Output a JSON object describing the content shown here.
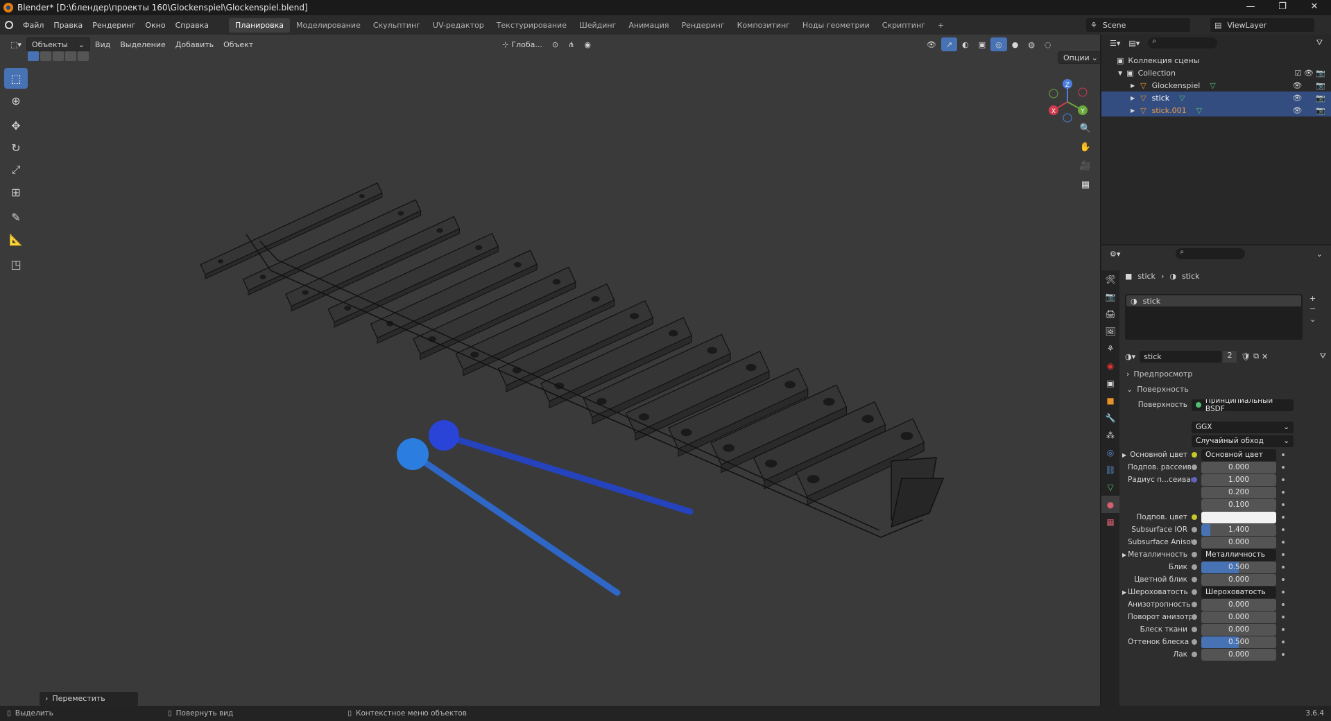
{
  "window": {
    "title": "Blender* [D:\\блендер\\проекты 160\\Glockenspiel\\Glockenspiel.blend]"
  },
  "menu": [
    "Файл",
    "Правка",
    "Рендеринг",
    "Окно",
    "Справка"
  ],
  "workspaces": {
    "active": "Планировка",
    "tabs": [
      "Моделирование",
      "Скульптинг",
      "UV-редактор",
      "Текстурирование",
      "Шейдинг",
      "Анимация",
      "Рендеринг",
      "Композитинг",
      "Ноды геометрии",
      "Скриптинг"
    ],
    "add": "+"
  },
  "scene": {
    "name": "Scene",
    "view_layer": "ViewLayer"
  },
  "viewport": {
    "mode": "Объекты",
    "menu": [
      "Вид",
      "Выделение",
      "Добавить",
      "Объект"
    ],
    "transform_orientation": "Глоба...",
    "options": "Опции",
    "last_operator": "Переместить"
  },
  "gizmo": {
    "x": "X",
    "y": "Y",
    "z": "Z"
  },
  "outliner": {
    "root": "Коллекция сцены",
    "collection": "Collection",
    "objects": [
      {
        "name": "Glockenspiel",
        "selected": false,
        "color": "#d6d6d6"
      },
      {
        "name": "stick",
        "selected": true,
        "color": "#ffffff"
      },
      {
        "name": "stick.001",
        "selected": true,
        "color": "#f0a040"
      }
    ]
  },
  "properties": {
    "breadcrumb": [
      "stick",
      "stick"
    ],
    "material_slot": "stick",
    "material_name": "stick",
    "users": "2",
    "panels": {
      "preview": "Предпросмотр",
      "surface": "Поверхность"
    },
    "surface_label": "Поверхность",
    "surface_shader": "Принципиальный BSDF",
    "distribution": "GGX",
    "subsurface_method": "Случайный обход",
    "rows": [
      {
        "label": "Основной цвет",
        "value": "Основной цвет",
        "type": "link",
        "sock": "#c7c729",
        "expand": true
      },
      {
        "label": "Подпов. рассеива...",
        "value": "0.000",
        "type": "num",
        "sock": "#a1a1a1",
        "fill": 0
      },
      {
        "label": "Радиус п...сеивания",
        "value": "1.000",
        "type": "num",
        "sock": "#6363c7",
        "fill": 0
      },
      {
        "label": "",
        "value": "0.200",
        "type": "num",
        "sock": "",
        "fill": 0
      },
      {
        "label": "",
        "value": "0.100",
        "type": "num",
        "sock": "",
        "fill": 0
      },
      {
        "label": "Подпов. цвет",
        "value": "",
        "type": "color",
        "sock": "#c7c729",
        "fill": 0
      },
      {
        "label": "Subsurface IOR",
        "value": "1.400",
        "type": "num",
        "sock": "#a1a1a1",
        "fill": 0.12
      },
      {
        "label": "Subsurface Anisotr...",
        "value": "0.000",
        "type": "num",
        "sock": "#a1a1a1",
        "fill": 0
      },
      {
        "label": "Металличность",
        "value": "Металличность",
        "type": "link",
        "sock": "#a1a1a1",
        "expand": true
      },
      {
        "label": "Блик",
        "value": "0.500",
        "type": "num",
        "sock": "#a1a1a1",
        "fill": 0.5
      },
      {
        "label": "Цветной блик",
        "value": "0.000",
        "type": "num",
        "sock": "#a1a1a1",
        "fill": 0
      },
      {
        "label": "Шероховатость",
        "value": "Шероховатость",
        "type": "link",
        "sock": "#a1a1a1",
        "expand": true
      },
      {
        "label": "Анизотропность",
        "value": "0.000",
        "type": "num",
        "sock": "#a1a1a1",
        "fill": 0
      },
      {
        "label": "Поворот анизотро...",
        "value": "0.000",
        "type": "num",
        "sock": "#a1a1a1",
        "fill": 0
      },
      {
        "label": "Блеск ткани",
        "value": "0.000",
        "type": "num",
        "sock": "#a1a1a1",
        "fill": 0
      },
      {
        "label": "Оттенок блеска тк...",
        "value": "0.500",
        "type": "num",
        "sock": "#a1a1a1",
        "fill": 0.5
      },
      {
        "label": "Лак",
        "value": "0.000",
        "type": "num",
        "sock": "#a1a1a1",
        "fill": 0
      }
    ]
  },
  "statusbar": {
    "select": "Выделить",
    "rotate": "Повернуть вид",
    "context": "Контекстное меню объектов",
    "version": "3.6.4"
  }
}
